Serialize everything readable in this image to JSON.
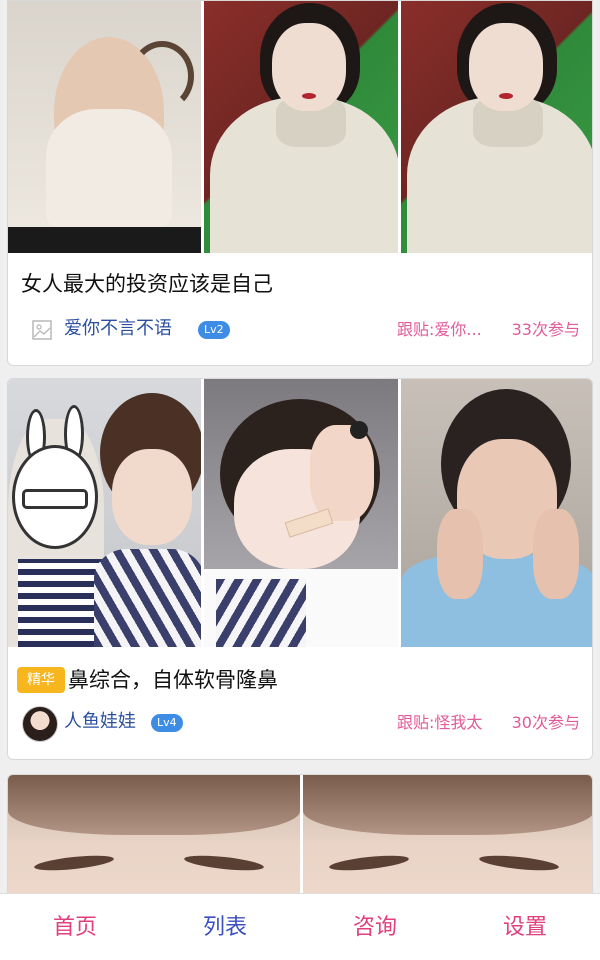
{
  "posts": [
    {
      "title": "女人最大的投资应该是自己",
      "author": "爱你不言不语",
      "level": "Lv2",
      "follow": "跟贴:爱你...",
      "count": "33次参与"
    },
    {
      "badge": "精华",
      "title": "鼻综合，自体软骨隆鼻",
      "author": "人鱼娃娃",
      "level": "Lv4",
      "follow": "跟贴:怪我太",
      "count": "30次参与"
    }
  ],
  "tabbar": {
    "home": "首页",
    "list": "列表",
    "consult": "咨询",
    "settings": "设置"
  },
  "colors": {
    "author": "#2b4f9e",
    "meta_pink": "#e05a99",
    "level_badge": "#3d8ce6",
    "essence_badge": "#f7b51e",
    "tab_pink": "#e0407e",
    "tab_blue": "#3b4fbf"
  },
  "icons": {
    "author_placeholder": "image-placeholder-icon"
  }
}
